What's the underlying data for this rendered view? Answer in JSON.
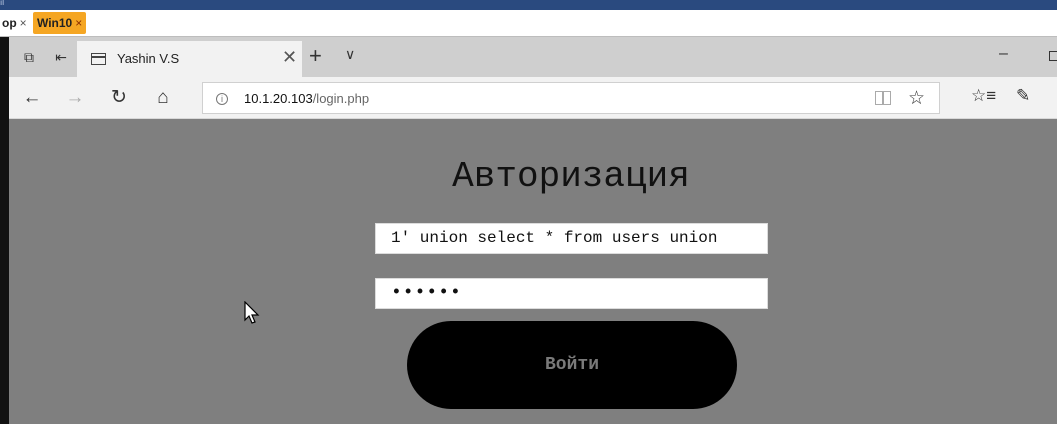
{
  "host": {
    "tabs": [
      {
        "label": "op",
        "close": "×"
      },
      {
        "label": "Win10",
        "close": "×"
      }
    ]
  },
  "browser": {
    "tab_title": "Yashin V.S",
    "tab_close": "✕",
    "new_tab": "+",
    "tab_list": "∨",
    "minimize": "–",
    "address": {
      "host": "10.1.20.103",
      "path": "/login.php"
    }
  },
  "page": {
    "title": "Авторизация",
    "username_value": "1' union select * from users union",
    "password_value": "••••••",
    "login_button": "Войти"
  },
  "icons": [
    "back-icon",
    "forward-icon",
    "refresh-icon",
    "home-icon",
    "info-icon",
    "reading-view-icon",
    "favorite-star-icon",
    "hub-icon",
    "web-note-icon",
    "tab-icon",
    "mouse-cursor-icon"
  ]
}
